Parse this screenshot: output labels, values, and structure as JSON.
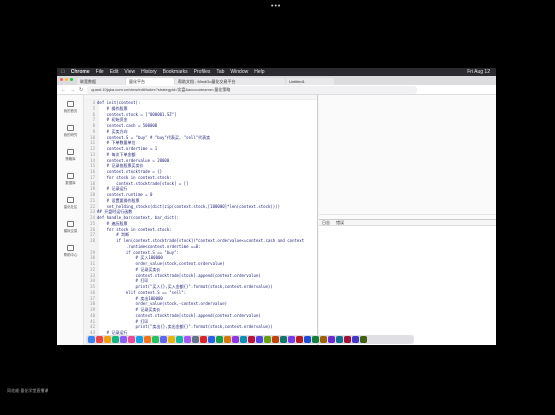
{
  "window_dots": "•••",
  "menubar": {
    "apple": "",
    "items": [
      "Chrome",
      "File",
      "Edit",
      "View",
      "History",
      "Bookmarks",
      "Profiles",
      "Tab",
      "Window",
      "Help"
    ],
    "clock": "Fri Aug 12"
  },
  "tabs": [
    {
      "label": "联宽数据"
    },
    {
      "label": "量化平台"
    },
    {
      "label": "帮助文档 - MindGo量化交易平台"
    },
    {
      "label": "Untitled1"
    }
  ],
  "address": "quant.10jqka.com.cn/view/edit/index?strategyid=实盘&accountname=量化策略",
  "sidebar": [
    {
      "icon": "home-icon",
      "label": "我的首页"
    },
    {
      "icon": "research-icon",
      "label": "我的研究"
    },
    {
      "icon": "strategy-icon",
      "label": "策略库"
    },
    {
      "icon": "data-icon",
      "label": "数据库"
    },
    {
      "icon": "community-icon",
      "label": "量化社区"
    },
    {
      "icon": "trade-icon",
      "label": "模拟交易"
    },
    {
      "icon": "help-icon",
      "label": "帮助中心"
    }
  ],
  "code_lines": [
    {
      "n": "4",
      "t": "def init(context):"
    },
    {
      "n": "5",
      "t": "    # 操作股票"
    },
    {
      "n": "6",
      "t": "    context.stock = [\"000001.SZ\"]"
    },
    {
      "n": "7",
      "t": "    # 初始资金"
    },
    {
      "n": "8",
      "t": "    context.cash = 500000"
    },
    {
      "n": "9",
      "t": "    # 买卖方向"
    },
    {
      "n": "10",
      "t": "    context.S = \"buy\" # \"buy\"代表买, \"sell\"代表卖"
    },
    {
      "n": "11",
      "t": "    # 下单数量单位"
    },
    {
      "n": "12",
      "t": "    context.ordertime = 1"
    },
    {
      "n": "13",
      "t": "    # 每次下单金额"
    },
    {
      "n": "14",
      "t": "    context.ordervalue = 20000"
    },
    {
      "n": "15",
      "t": "    # 记录各股票买卖价"
    },
    {
      "n": "16",
      "t": "    context.stocktrade = {}"
    },
    {
      "n": "17",
      "t": "    for stock in context.stock:"
    },
    {
      "n": "18",
      "t": "        context.stocktrade[stock] = []"
    },
    {
      "n": "19",
      "t": "    # 记录运行"
    },
    {
      "n": "20",
      "t": "    context.runtime = 0"
    },
    {
      "n": "21",
      "t": "    # 设置要操作股票"
    },
    {
      "n": "22",
      "t": "    set_holding_stocks(dict(zip(context.stock,[100000]*len(context.stock))))"
    },
    {
      "n": "23",
      "t": "## 开盘时运行函数"
    },
    {
      "n": "24",
      "t": "def handle_bar(context, bar_dict):"
    },
    {
      "n": "25",
      "t": "    # 遍历股票"
    },
    {
      "n": "26",
      "t": "    for stock in context.stock:"
    },
    {
      "n": "27",
      "t": "        # 判断"
    },
    {
      "n": "28",
      "t": "        if len(context.stocktrade[stock])*context.ordervalue<=context.cash and context"
    },
    {
      "n": "",
      "t": "            .runtime<context.ordertime ==0:"
    },
    {
      "n": "29",
      "t": "            if context.S == \"buy\":"
    },
    {
      "n": "30",
      "t": "                # 买入100000"
    },
    {
      "n": "31",
      "t": "                order_value(stock,context.ordervalue)"
    },
    {
      "n": "32",
      "t": "                # 记录买卖价"
    },
    {
      "n": "33",
      "t": "                context.stocktrade[stock].append(context.ordervalue)"
    },
    {
      "n": "34",
      "t": "                # 打印"
    },
    {
      "n": "35",
      "t": "                print(\"买入{},买入金额{}\".format(stock,context.ordervalue))"
    },
    {
      "n": "36",
      "t": "            elif context.S == \"sell\":"
    },
    {
      "n": "37",
      "t": "                # 卖出100000"
    },
    {
      "n": "38",
      "t": "                order_value(stock,-context.ordervalue)"
    },
    {
      "n": "39",
      "t": "                # 记录买卖价"
    },
    {
      "n": "40",
      "t": "                context.stocktrade[stock].append(context.ordervalue)"
    },
    {
      "n": "41",
      "t": "                # 打印"
    },
    {
      "n": "42",
      "t": "                print(\"卖出{},卖出金额{}\".format(stock,context.ordervalue))"
    },
    {
      "n": "43",
      "t": "    # 记录运行"
    },
    {
      "n": "44",
      "t": "    context.runtime+=1"
    }
  ],
  "panel_tabs": [
    "日志",
    "错误"
  ],
  "camera_label": "同花顺·量化学堂直播课",
  "colors": {
    "traffic": [
      "#ff5f57",
      "#febc2e",
      "#28c840"
    ],
    "dock": [
      "#3b82f6",
      "#ef4444",
      "#f59e0b",
      "#10b981",
      "#8b5cf6",
      "#ec4899",
      "#0ea5e9",
      "#f97316",
      "#22c55e",
      "#6366f1",
      "#eab308",
      "#14b8a6",
      "#a855f7",
      "#64748b",
      "#dc2626",
      "#2563eb",
      "#16a34a",
      "#d97706",
      "#9333ea",
      "#0891b2",
      "#be123c",
      "#4f46e5",
      "#65a30d",
      "#c2410c",
      "#0f766e",
      "#7c3aed",
      "#b91c1c",
      "#1d4ed8",
      "#15803d",
      "#a16207",
      "#6d28d9",
      "#0e7490",
      "#9f1239",
      "#4338ca",
      "#3f6212"
    ]
  }
}
